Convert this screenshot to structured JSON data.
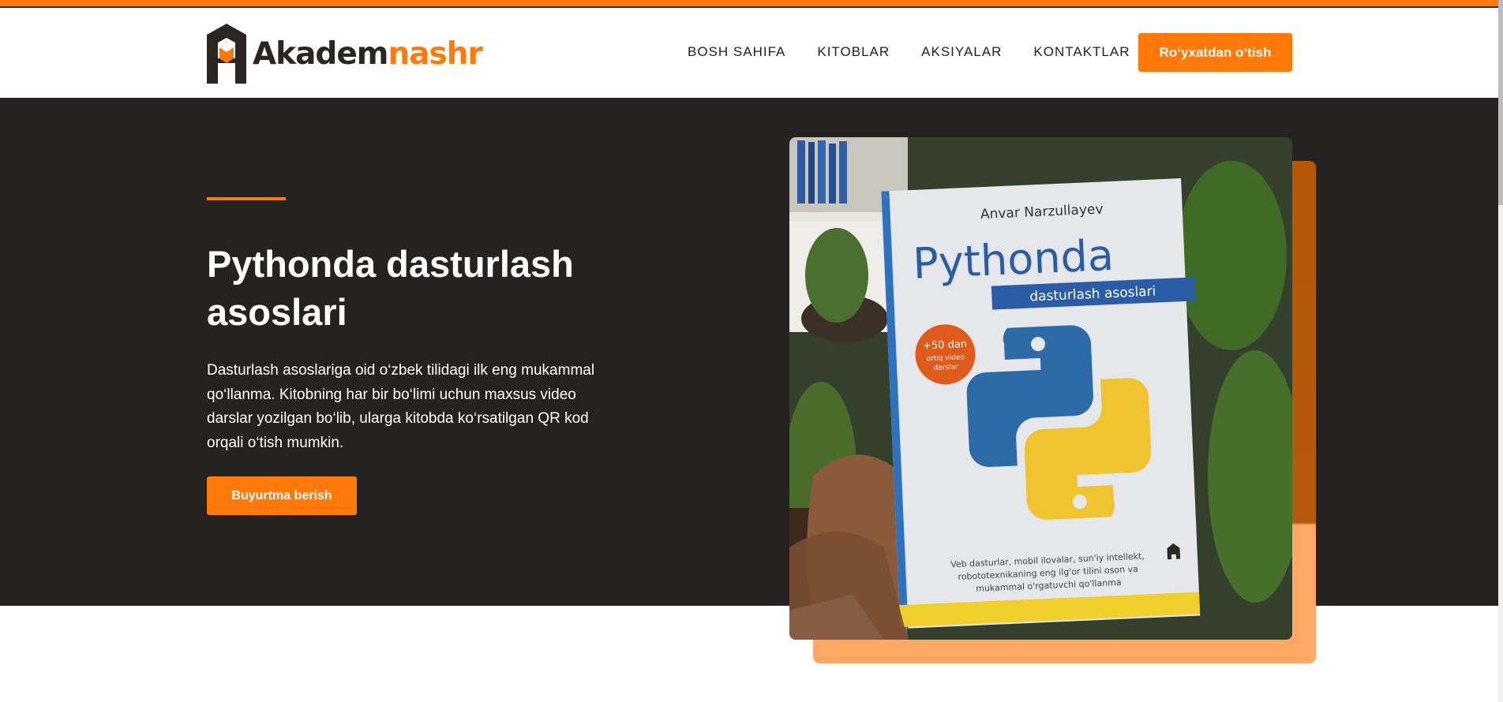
{
  "brand": {
    "name_part1": "Akadem",
    "name_part2": "nashr",
    "primary_color": "#ff7a0a",
    "dark_color": "#252321"
  },
  "nav": {
    "items": [
      "BOSH SAHIFA",
      "KITOBLAR",
      "AKSIYALAR",
      "KONTAKTLAR"
    ],
    "register_label": "Ro‘yxatdan o‘tish"
  },
  "hero": {
    "title": "Pythonda dasturlash asoslari",
    "description": "Dasturlash asoslariga oid o‘zbek tilidagi ilk eng mukammal qo‘llanma. Kitobning har bir bo‘limi uchun maxsus video darslar yozilgan bo‘lib, ularga kitobda ko‘rsatilgan QR kod orqali o‘tish mumkin.",
    "order_label": "Buyurtma berish"
  },
  "book": {
    "author": "Anvar Narzullayev",
    "title": "Pythonda",
    "subtitle": "dasturlash asoslari",
    "badge_line1": "+50 dan",
    "badge_line2": "ortiq video",
    "badge_line3": "darslar",
    "footer_line1": "Veb dasturlar, mobil ilovalar, sun'iy intellekt,",
    "footer_line2": "robototexnikaning eng ilg'or tilini oson va",
    "footer_line3": "mukammal o'rgatuvchi qo'llanma",
    "icon": "python-logo-icon"
  }
}
